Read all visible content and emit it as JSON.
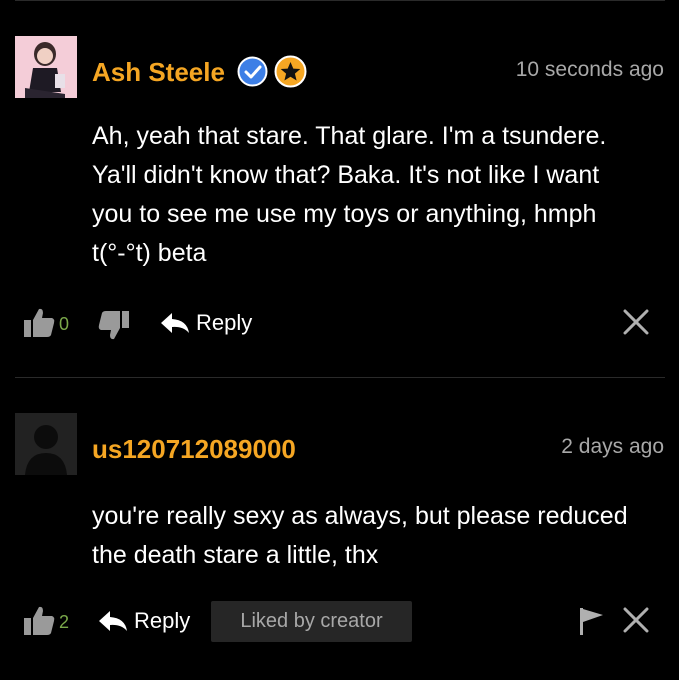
{
  "comments": [
    {
      "username": "Ash Steele",
      "verified_icon": "verified-check-icon",
      "badge_icon": "star-badge-icon",
      "time": "10 seconds ago",
      "body_lines": [
        "Ah, yeah that stare. That glare. I'm a tsundere.",
        "Ya'll didn't know that? Baka. It's not like I want",
        "you to see me use my toys or anything, hmph",
        "t(°-°t) beta"
      ],
      "likes": "0",
      "reply_label": "Reply"
    },
    {
      "username": "us120712089000",
      "time": "2 days ago",
      "body_lines": [
        "you're really sexy as always, but please reduced",
        "the death stare a little, thx"
      ],
      "likes": "2",
      "reply_label": "Reply",
      "liked_by_creator": "Liked by creator"
    }
  ],
  "colors": {
    "username": "#f5a623",
    "verified": "#3d7fe6",
    "badge": "#f5a623",
    "count": "#7aa84a",
    "muted": "#a8a8a8"
  }
}
